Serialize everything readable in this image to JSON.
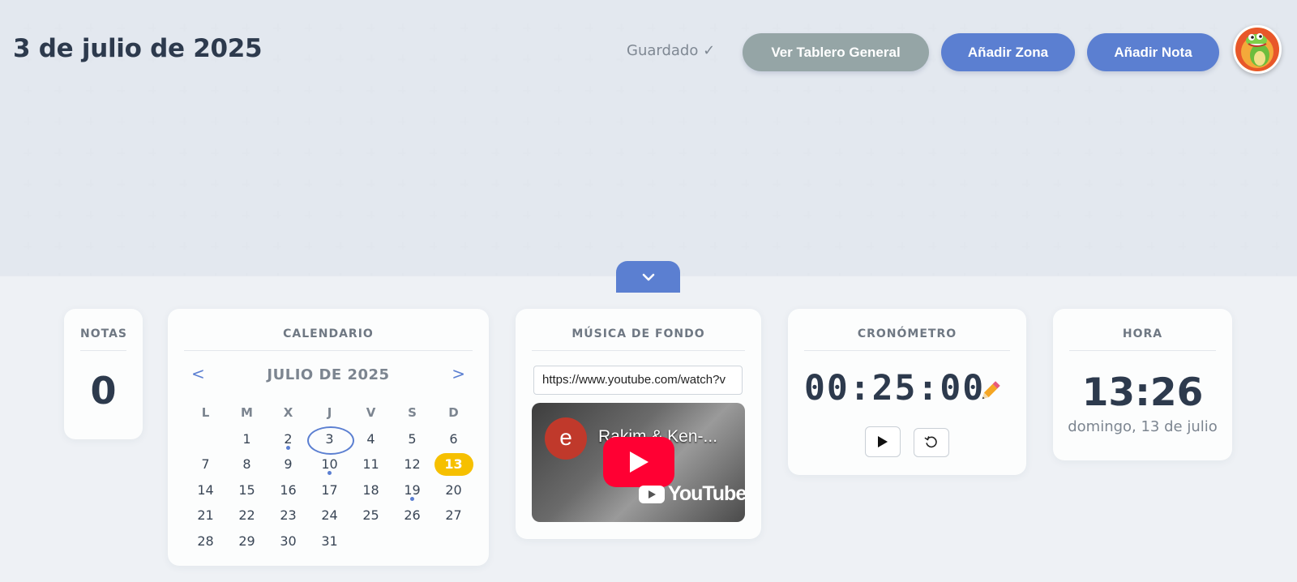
{
  "header": {
    "date_title": "3 de julio de 2025",
    "saved_status": "Guardado ✓",
    "btn_general": "Ver Tablero General",
    "btn_zona": "Añadir Zona",
    "btn_nota": "Añadir Nota",
    "avatar_icon": "crocodile-mascot-icon"
  },
  "collapse_icon": "chevron-down-icon",
  "notas": {
    "title": "NOTAS",
    "count": "0"
  },
  "calendar": {
    "title": "CALENDARIO",
    "prev": "<",
    "next": ">",
    "month": "JULIO DE 2025",
    "weekdays": [
      "L",
      "M",
      "X",
      "J",
      "V",
      "S",
      "D"
    ],
    "weeks": [
      [
        "",
        "1",
        "2",
        "3",
        "4",
        "5",
        "6"
      ],
      [
        "7",
        "8",
        "9",
        "10",
        "11",
        "12",
        "13"
      ],
      [
        "14",
        "15",
        "16",
        "17",
        "18",
        "19",
        "20"
      ],
      [
        "21",
        "22",
        "23",
        "24",
        "25",
        "26",
        "27"
      ],
      [
        "28",
        "29",
        "30",
        "31",
        "",
        "",
        ""
      ]
    ],
    "selected_day": "3",
    "today": "13",
    "days_with_notes": [
      "2",
      "10",
      "19"
    ],
    "today_color": "#f6c000",
    "accent_color": "#5b7fd1"
  },
  "music": {
    "title": "MÚSICA DE FONDO",
    "url": "https://www.youtube.com/watch?v",
    "video_channel_initial": "e",
    "video_title": "Rakim & Ken-...",
    "youtube_label": "YouTube"
  },
  "chrono": {
    "title": "CRONÓMETRO",
    "time": "00:25:00",
    "edit_icon": "pencil-icon",
    "play_icon": "play-icon",
    "reset_icon": "reset-icon"
  },
  "hora": {
    "title": "HORA",
    "time": "13:26",
    "date": "domingo, 13 de julio"
  }
}
